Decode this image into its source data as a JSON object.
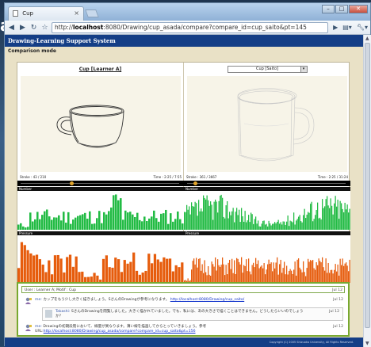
{
  "browser": {
    "tab_title": "Cup",
    "tab_close": "×",
    "url_prefix": "http://",
    "url_host": "localhost",
    "url_rest": ":8080/Drawing/cup_asada/compare?compare_id=cup_saito&pt=145",
    "controls": {
      "minimize": "–",
      "maximize": "□",
      "close": "✕"
    }
  },
  "desktop": {
    "edge_letter": "a"
  },
  "app": {
    "title": "Drawing-Learning Support System",
    "mode": "Comparison mode",
    "footer": "Copyright (C) 2005 Shizuoka University, All Rights Reserved."
  },
  "left_panel": {
    "heading": "Cup [Learner A]",
    "stroke": "Stroke : 43 / 210",
    "time": "Time : 2:25 / 7:55",
    "knob_position": 0.32,
    "number_label": "Number",
    "pressure_label": "Pressure",
    "number_color": "#22bb44",
    "pressure_color": "#e65c0c"
  },
  "right_panel": {
    "select_value": "Cup [Saito]",
    "stroke": "Stroke : 361 / 3667",
    "time": "Time : 2:25 / 31:24",
    "knob_position": 0.05,
    "number_label": "Number",
    "pressure_label": "Pressure",
    "number_color": "#22bb44",
    "pressure_color": "#e65c0c"
  },
  "comments": {
    "first": {
      "text": "User : Learner A; Motif : Cup",
      "date": "Jul 12"
    },
    "items": [
      {
        "author": "me:",
        "text": "カップをもう少し大きく描きましょう。SさんのDrawingが参考になります。",
        "url": "http://localhost:8080/Drawing/cup_saito/",
        "date": "Jul 12"
      },
      {
        "author": "Takashi:",
        "text": "SさんのDrawingを閲覧しました。大きく描かれていました。でも、私には、あの大きさで描くことはできません。どうしたらいいのでしょうか？",
        "date": "Jul 12"
      },
      {
        "author": "me:",
        "text": "Drawingの初期段階において、線量が異なります。薄い線を描画してからとっていきましょう。参考",
        "url_prefix": "URL:",
        "url": "http://localhost:8080/Drawing/cup_asada/compare?compare_id=cup_saito&pt=156",
        "date": "Jul 12"
      }
    ]
  }
}
